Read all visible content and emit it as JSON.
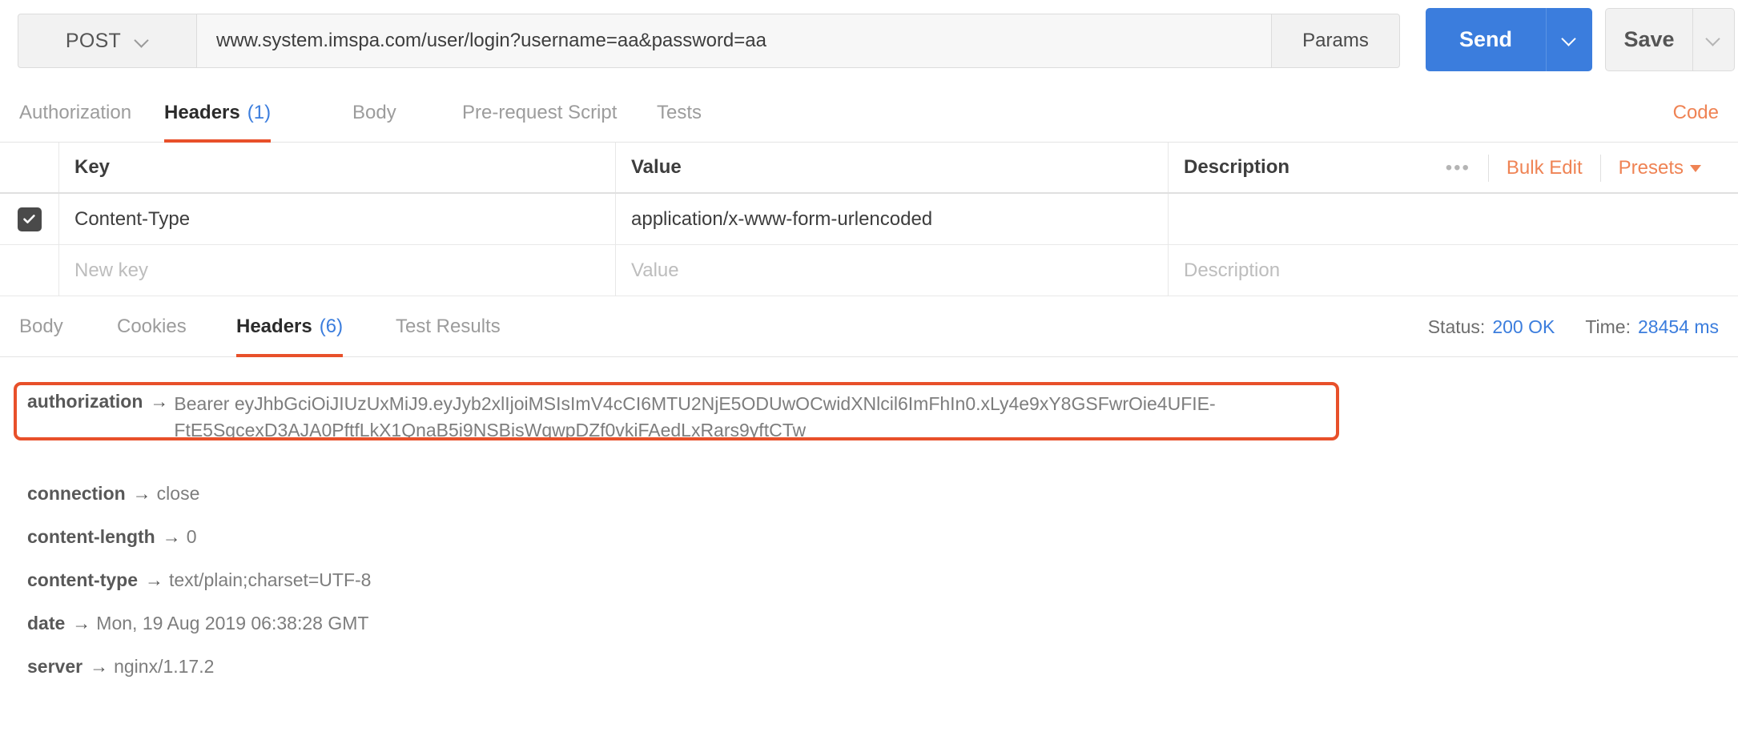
{
  "request": {
    "method": "POST",
    "method_caret_icon": "chevron-down-icon",
    "url": "www.system.imspa.com/user/login?username=aa&password=aa",
    "params_label": "Params",
    "send_label": "Send",
    "send_caret_icon": "chevron-down-icon",
    "save_label": "Save",
    "save_caret_icon": "chevron-down-icon",
    "accent_blue": "#3b7ddd",
    "accent_orange": "#e8502a"
  },
  "request_tabs": [
    {
      "label": "Authorization",
      "count": "",
      "active": false
    },
    {
      "label": "Headers",
      "count": "(1)",
      "active": true
    },
    {
      "label": "Body",
      "count": "",
      "active": false
    },
    {
      "label": "Pre-request Script",
      "count": "",
      "active": false
    },
    {
      "label": "Tests",
      "count": "",
      "active": false
    }
  ],
  "code_link": "Code",
  "headers_table": {
    "columns": [
      "Key",
      "Value",
      "Description"
    ],
    "actions": {
      "more_icon": "ellipsis-icon",
      "more_label": "•••",
      "bulk_edit": "Bulk Edit",
      "presets": "Presets"
    },
    "rows": [
      {
        "checked": true,
        "key": "Content-Type",
        "value": "application/x-www-form-urlencoded",
        "description": ""
      }
    ],
    "new_row": {
      "key_placeholder": "New key",
      "value_placeholder": "Value",
      "description_placeholder": "Description"
    }
  },
  "response_tabs": [
    {
      "label": "Body",
      "count": "",
      "active": false
    },
    {
      "label": "Cookies",
      "count": "",
      "active": false
    },
    {
      "label": "Headers",
      "count": "(6)",
      "active": true
    },
    {
      "label": "Test Results",
      "count": "",
      "active": false
    }
  ],
  "response_meta": {
    "status_label": "Status:",
    "status_value": "200 OK",
    "time_label": "Time:",
    "time_value": "28454 ms"
  },
  "response_headers": [
    {
      "key": "authorization",
      "arrow": "→",
      "value": "Bearer eyJhbGciOiJIUzUxMiJ9.eyJyb2xlIjoiMSIsImV4cCI6MTU2NjE5ODUwOCwidXNlcil6ImFhIn0.xLy4e9xY8GSFwrOie4UFIE-FtE5SgcexD3AJA0PftfLkX1QnaB5i9NSBisWqwpDZf0vkiFAedLxRars9yftCTw",
      "highlighted": true
    },
    {
      "key": "connection",
      "arrow": "→",
      "value": "close",
      "highlighted": false
    },
    {
      "key": "content-length",
      "arrow": "→",
      "value": "0",
      "highlighted": false
    },
    {
      "key": "content-type",
      "arrow": "→",
      "value": "text/plain;charset=UTF-8",
      "highlighted": false
    },
    {
      "key": "date",
      "arrow": "→",
      "value": "Mon, 19 Aug 2019 06:38:28 GMT",
      "highlighted": false
    },
    {
      "key": "server",
      "arrow": "→",
      "value": "nginx/1.17.2",
      "highlighted": false
    }
  ]
}
